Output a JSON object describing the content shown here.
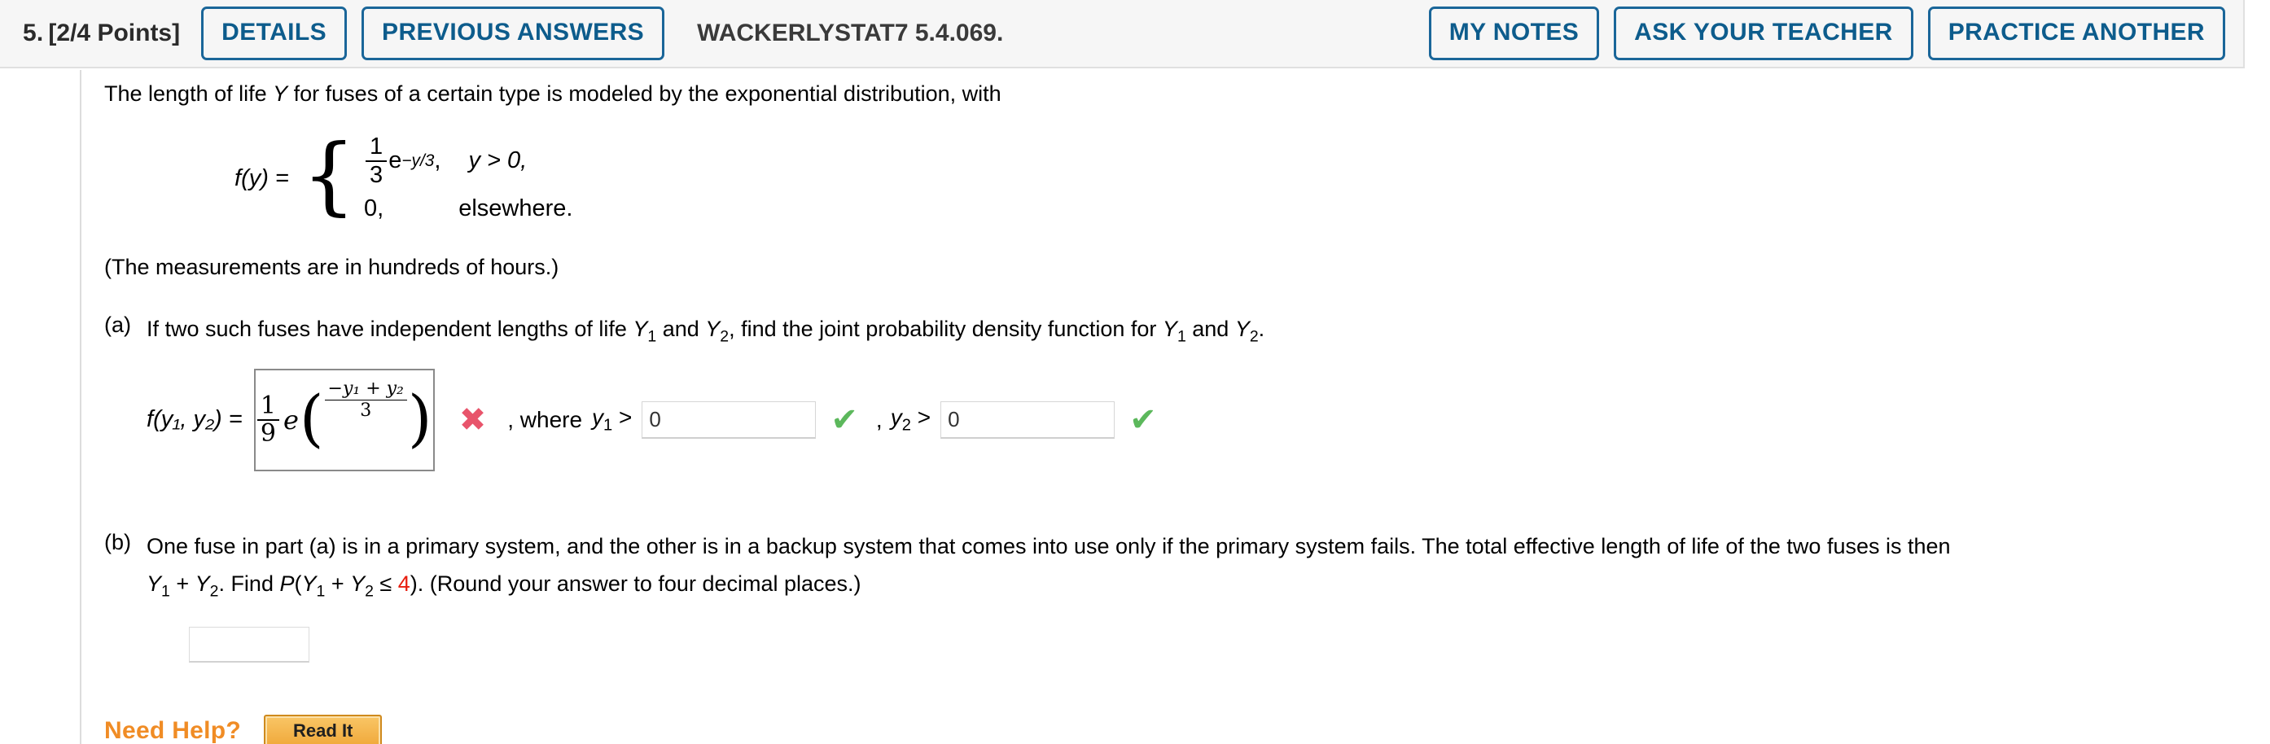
{
  "header": {
    "question_number": "5.",
    "points": "[2/4 Points]",
    "details_label": "DETAILS",
    "previous_answers_label": "PREVIOUS ANSWERS",
    "question_title": "WACKERLYSTAT7 5.4.069.",
    "my_notes_label": "MY NOTES",
    "ask_teacher_label": "ASK YOUR TEACHER",
    "practice_another_label": "PRACTICE ANOTHER"
  },
  "problem": {
    "intro_1": "The length of life ",
    "intro_var": "Y",
    "intro_2": " for fuses of a certain type is modeled by the exponential distribution, with",
    "piecewise": {
      "lhs_f": "f",
      "lhs_arg": "(y) =",
      "row1_frac_num": "1",
      "row1_frac_den": "3",
      "row1_base": "e",
      "row1_exp": "−y/3",
      "row1_comma": ",",
      "row1_cond": "y > 0,",
      "row2_value": "0,",
      "row2_cond": "elsewhere."
    },
    "measurements_note": "(The measurements are in hundreds of hours.)"
  },
  "part_a": {
    "label": "(a)",
    "text_1": "If two such fuses have independent lengths of life ",
    "var_y1": "Y",
    "sub_1": "1",
    "text_2": " and ",
    "var_y2": "Y",
    "sub_2": "2",
    "text_3": ", find the joint probability density function for ",
    "var_y1b": "Y",
    "sub_1b": "1",
    "text_4": " and ",
    "var_y2b": "Y",
    "sub_2b": "2",
    "text_5": ".",
    "answer_lhs_f": "f",
    "answer_lhs_rest": "(y₁, y₂) =",
    "answer_expr": {
      "coef_num": "1",
      "coef_den": "9",
      "base": "e",
      "exp_num": "−y₁ + y₂",
      "exp_den": "3"
    },
    "grade_mark_wrong": "✖",
    "where_text": ", where",
    "cond1_var": "y",
    "cond1_sub": "1",
    "cond1_op": ">",
    "cond1_value": "0",
    "cond1_mark": "✔",
    "cond2_sep": ",",
    "cond2_var": "y",
    "cond2_sub": "2",
    "cond2_op": ">",
    "cond2_value": "0",
    "cond2_mark": "✔"
  },
  "part_b": {
    "label": "(b)",
    "line1": "One fuse in part (a) is in a primary system, and the other is in a backup system that comes into use only if the primary system fails. The total effective length of life of the two fuses is then",
    "line2_a": "Y",
    "line2_sub1": "1",
    "line2_b": " + ",
    "line2_c": "Y",
    "line2_sub2": "2",
    "line2_d": ". Find ",
    "line2_p": "P",
    "line2_e": "(",
    "line2_f": "Y",
    "line2_sub3": "1",
    "line2_g": " + ",
    "line2_h": "Y",
    "line2_sub4": "2",
    "line2_i": " ≤ ",
    "line2_value": "4",
    "line2_j": "). (Round your answer to four decimal places.)",
    "answer_value": ""
  },
  "need_help": {
    "label": "Need Help?",
    "read_it_label": "Read It"
  },
  "colors": {
    "accent_blue": "#0d5c8c",
    "wrong_red": "#e8546b",
    "correct_green": "#5cb85c",
    "highlight_red": "#e81d0e",
    "help_orange": "#f08c25"
  }
}
